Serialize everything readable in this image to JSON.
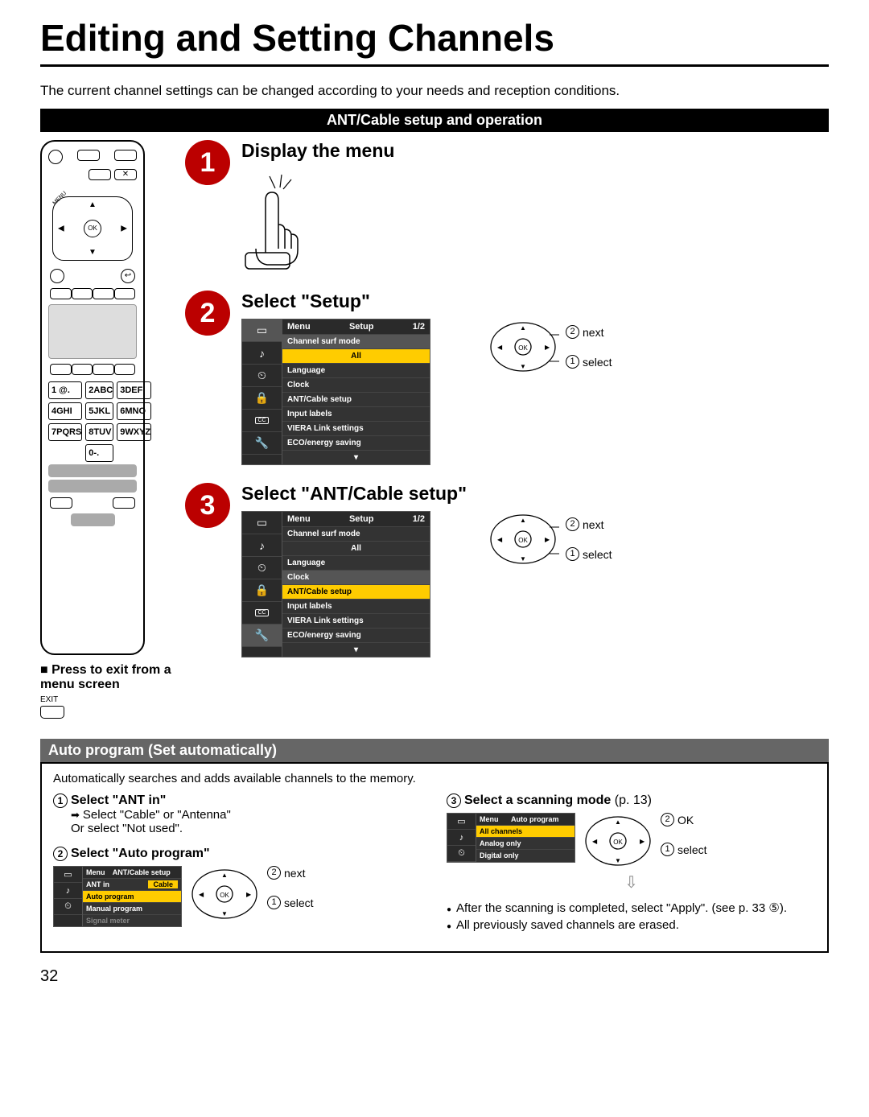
{
  "title": "Editing and Setting Channels",
  "intro": "The current channel settings can be changed according to your needs and reception conditions.",
  "section_bar": "ANT/Cable setup and operation",
  "remote": {
    "menu_label": "MENU",
    "ok_label": "OK",
    "keys": [
      "1 @.",
      "2ABC",
      "3DEF",
      "4GHI",
      "5JKL",
      "6MNO",
      "7PQRS",
      "8TUV",
      "9WXYZ",
      "",
      "0-.",
      ""
    ]
  },
  "press_exit": {
    "heading": "■ Press to exit from a menu screen",
    "exit_label": "EXIT"
  },
  "steps": [
    {
      "num": "1",
      "title": "Display the menu"
    },
    {
      "num": "2",
      "title": "Select \"Setup\""
    },
    {
      "num": "3",
      "title": "Select \"ANT/Cable setup\""
    }
  ],
  "setup_menu": {
    "head_left": "Menu",
    "head_title": "Setup",
    "head_page": "1/2",
    "items": [
      "Channel surf mode",
      "All",
      "Language",
      "Clock",
      "ANT/Cable setup",
      "Input labels",
      "VIERA Link settings",
      "ECO/energy saving"
    ]
  },
  "dpad": {
    "next": "next",
    "select": "select",
    "ok": "OK"
  },
  "auto_program": {
    "bar": "Auto program (Set automatically)",
    "desc": "Automatically searches and adds available channels to the memory.",
    "s1_title": "Select \"ANT in\"",
    "s1_line1": "Select \"Cable\" or \"Antenna\"",
    "s1_line2": "Or select \"Not used\".",
    "s2_title": "Select \"Auto program\"",
    "s3_title": "Select a scanning mode",
    "s3_page": "(p. 13)",
    "ant_menu": {
      "head_left": "Menu",
      "head_title": "ANT/Cable setup",
      "items": [
        "Auto program",
        "Manual program",
        "Signal meter"
      ],
      "ant_in_label": "ANT in",
      "ant_in_value": "Cable"
    },
    "scan_menu": {
      "head_left": "Menu",
      "head_title": "Auto program",
      "items": [
        "All channels",
        "Analog only",
        "Digital only"
      ]
    },
    "note1": "After the scanning is completed, select \"Apply\". (see p. 33 ⑤).",
    "note2": "All previously saved channels are erased."
  },
  "page_number": "32"
}
